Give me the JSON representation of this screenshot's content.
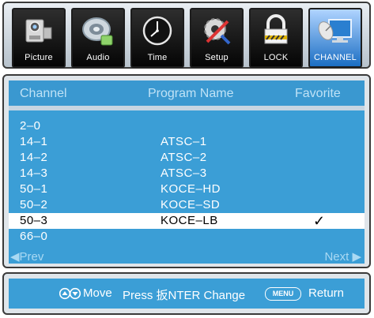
{
  "tabs": [
    {
      "label": "Picture",
      "icon": "camera-icon"
    },
    {
      "label": "Audio",
      "icon": "speaker-icon"
    },
    {
      "label": "Time",
      "icon": "clock-icon"
    },
    {
      "label": "Setup",
      "icon": "gear-tools-icon"
    },
    {
      "label": "LOCK",
      "icon": "lock-icon"
    },
    {
      "label": "CHANNEL",
      "icon": "satellite-monitor-icon",
      "active": true
    }
  ],
  "columns": {
    "channel": "Channel",
    "program": "Program Name",
    "favorite": "Favorite"
  },
  "rows": [
    {
      "channel": "2–0",
      "program": "",
      "favorite": false
    },
    {
      "channel": "14–1",
      "program": "ATSC–1",
      "favorite": false
    },
    {
      "channel": "14–2",
      "program": "ATSC–2",
      "favorite": false
    },
    {
      "channel": "14–3",
      "program": "ATSC–3",
      "favorite": false
    },
    {
      "channel": "50–1",
      "program": "KOCE–HD",
      "favorite": false
    },
    {
      "channel": "50–2",
      "program": "KOCE–SD",
      "favorite": false
    },
    {
      "channel": "50–3",
      "program": "KOCE–LB",
      "favorite": true,
      "selected": true
    },
    {
      "channel": "66–0",
      "program": "",
      "favorite": false
    }
  ],
  "favorite_mark": "✓",
  "pager": {
    "prev": "◀Prev",
    "next": "Next ▶"
  },
  "help": {
    "move": "Move",
    "enter": "Press 扳NTER Change",
    "menu_key": "MENU",
    "return": "Return"
  },
  "colors": {
    "list_bg": "#3b9ed6",
    "active_tab": "#1b6ec3",
    "selected_row": "#ffffff"
  }
}
